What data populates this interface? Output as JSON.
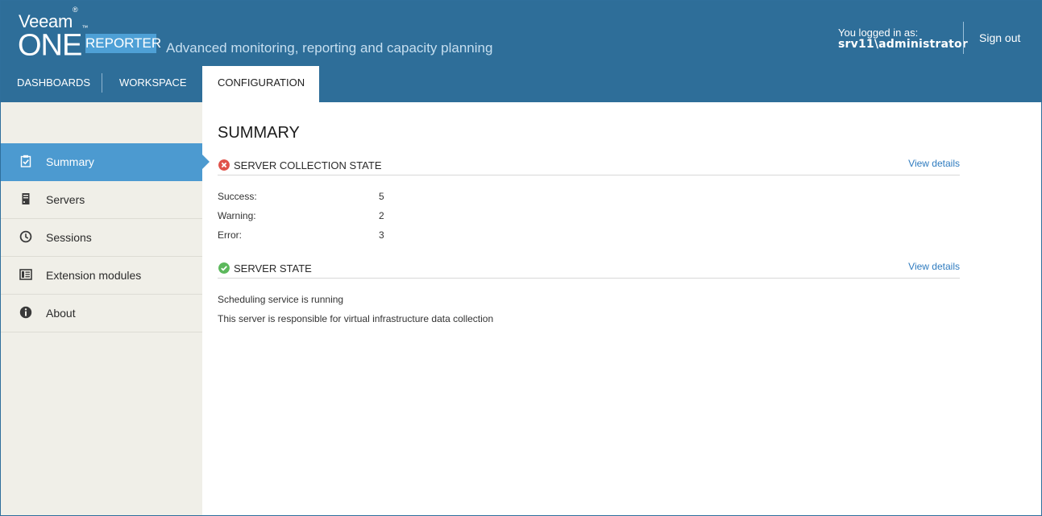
{
  "header": {
    "brand_top": "Veeam",
    "brand_top_mark": "®",
    "brand_main": "ONE",
    "brand_main_mark": "™",
    "product": "REPORTER",
    "tagline": "Advanced monitoring, reporting and capacity planning",
    "login_label": "You logged in as:",
    "login_user": "srv11\\administrator",
    "sign_out": "Sign out"
  },
  "nav": {
    "tabs": [
      {
        "label": "DASHBOARDS",
        "active": false
      },
      {
        "label": "WORKSPACE",
        "active": false
      },
      {
        "label": "CONFIGURATION",
        "active": true
      }
    ]
  },
  "sidebar": {
    "items": [
      {
        "label": "Summary",
        "icon": "clipboard-check-icon",
        "active": true
      },
      {
        "label": "Servers",
        "icon": "server-icon",
        "active": false
      },
      {
        "label": "Sessions",
        "icon": "clock-icon",
        "active": false
      },
      {
        "label": "Extension modules",
        "icon": "module-icon",
        "active": false
      },
      {
        "label": "About",
        "icon": "info-icon",
        "active": false
      }
    ]
  },
  "main": {
    "title": "SUMMARY",
    "collection": {
      "title": "SERVER COLLECTION STATE",
      "status": "error",
      "status_color": "#e0524a",
      "link": "View details",
      "rows": [
        {
          "label": "Success:",
          "value": "5"
        },
        {
          "label": "Warning:",
          "value": "2"
        },
        {
          "label": "Error:",
          "value": "3"
        }
      ]
    },
    "server_state": {
      "title": "SERVER STATE",
      "status": "ok",
      "status_color": "#5cb85c",
      "link": "View details",
      "lines": [
        "Scheduling service is running",
        "This server is responsible for virtual infrastructure data collection"
      ]
    }
  },
  "colors": {
    "header_bg": "#2e6e99",
    "accent": "#4c9ad0",
    "sidebar_bg": "#f0efe8",
    "link": "#2e7bbf"
  }
}
